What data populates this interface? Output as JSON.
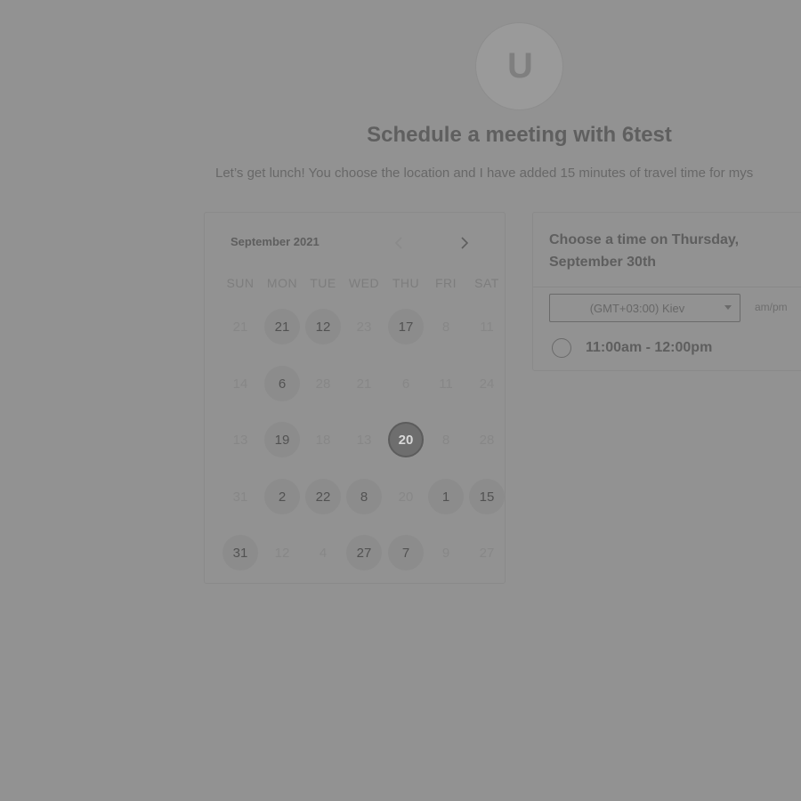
{
  "profile": {
    "avatar_text": "U"
  },
  "header": {
    "title": "Schedule a meeting with 6test",
    "subtitle": "Let’s get lunch! You choose the location and I have added 15 minutes of travel time for mys"
  },
  "calendar": {
    "month_label": "September 2021",
    "prev_icon": "chevron-left-icon",
    "next_icon": "chevron-right-icon",
    "weekdays": [
      "SUN",
      "MON",
      "TUE",
      "WED",
      "THU",
      "FRI",
      "SAT"
    ],
    "weeks": [
      [
        {
          "label": "21",
          "state": "muted"
        },
        {
          "label": "21",
          "state": "available"
        },
        {
          "label": "12",
          "state": "available"
        },
        {
          "label": "23",
          "state": "muted"
        },
        {
          "label": "17",
          "state": "available"
        },
        {
          "label": "8",
          "state": "muted"
        },
        {
          "label": "11",
          "state": "muted"
        }
      ],
      [
        {
          "label": "14",
          "state": "muted"
        },
        {
          "label": "6",
          "state": "available"
        },
        {
          "label": "28",
          "state": "muted"
        },
        {
          "label": "21",
          "state": "muted"
        },
        {
          "label": "6",
          "state": "muted"
        },
        {
          "label": "11",
          "state": "muted"
        },
        {
          "label": "24",
          "state": "muted"
        }
      ],
      [
        {
          "label": "13",
          "state": "muted"
        },
        {
          "label": "19",
          "state": "available"
        },
        {
          "label": "18",
          "state": "muted"
        },
        {
          "label": "13",
          "state": "muted"
        },
        {
          "label": "20",
          "state": "selected"
        },
        {
          "label": "8",
          "state": "muted"
        },
        {
          "label": "28",
          "state": "muted"
        }
      ],
      [
        {
          "label": "31",
          "state": "muted"
        },
        {
          "label": "2",
          "state": "available"
        },
        {
          "label": "22",
          "state": "available"
        },
        {
          "label": "8",
          "state": "available"
        },
        {
          "label": "20",
          "state": "muted"
        },
        {
          "label": "1",
          "state": "available"
        },
        {
          "label": "15",
          "state": "available"
        }
      ],
      [
        {
          "label": "31",
          "state": "available"
        },
        {
          "label": "12",
          "state": "muted"
        },
        {
          "label": "4",
          "state": "muted"
        },
        {
          "label": "27",
          "state": "available"
        },
        {
          "label": "7",
          "state": "available"
        },
        {
          "label": "9",
          "state": "muted"
        },
        {
          "label": "27",
          "state": "muted"
        }
      ]
    ]
  },
  "time_picker": {
    "heading": "Choose a time on Thursday, September 30th",
    "timezone_selected": "(GMT+03:00) Kiev",
    "format_label": "am/pm",
    "slots": [
      {
        "label": "11:00am - 12:00pm"
      }
    ]
  }
}
